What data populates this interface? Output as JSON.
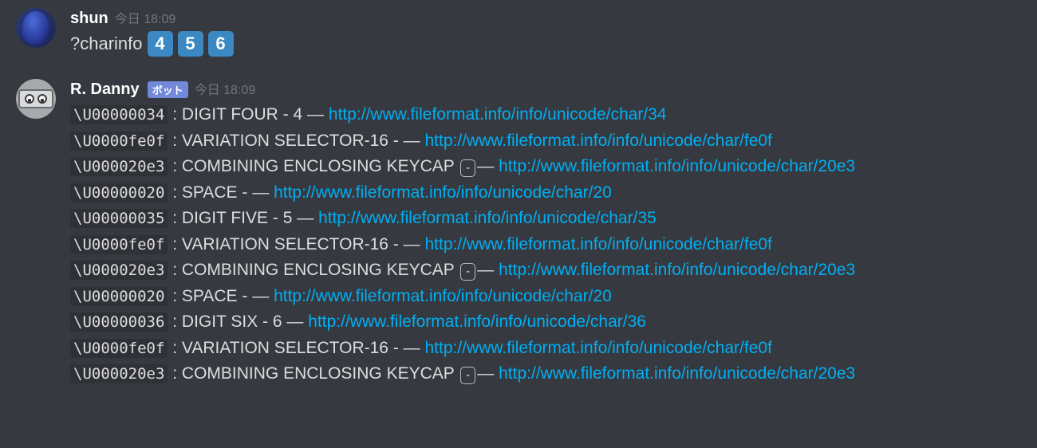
{
  "messages": [
    {
      "avatar_kind": "user",
      "username": "shun",
      "timestamp": "今日 18:09",
      "bot": false,
      "body": {
        "prefix": "?charinfo",
        "keycaps": [
          "4",
          "5",
          "6"
        ]
      }
    },
    {
      "avatar_kind": "bot",
      "username": "R. Danny",
      "timestamp": "今日 18:09",
      "bot": true,
      "bot_tag": "ボット",
      "lines": [
        {
          "code": "\\U00000034",
          "name": "DIGIT FOUR",
          "glyph": "4",
          "boxed": false,
          "url": "http://www.fileformat.info/info/unicode/char/34"
        },
        {
          "code": "\\U0000fe0f",
          "name": "VARIATION SELECTOR-16",
          "glyph": "",
          "boxed": false,
          "url": "http://www.fileformat.info/info/unicode/char/fe0f"
        },
        {
          "code": "\\U000020e3",
          "name": "COMBINING ENCLOSING KEYCAP",
          "glyph": "-",
          "boxed": true,
          "url": "http://www.fileformat.info/info/unicode/char/20e3"
        },
        {
          "code": "\\U00000020",
          "name": "SPACE",
          "glyph": " ",
          "boxed": false,
          "url": "http://www.fileformat.info/info/unicode/char/20"
        },
        {
          "code": "\\U00000035",
          "name": "DIGIT FIVE",
          "glyph": "5",
          "boxed": false,
          "url": "http://www.fileformat.info/info/unicode/char/35"
        },
        {
          "code": "\\U0000fe0f",
          "name": "VARIATION SELECTOR-16",
          "glyph": "",
          "boxed": false,
          "url": "http://www.fileformat.info/info/unicode/char/fe0f"
        },
        {
          "code": "\\U000020e3",
          "name": "COMBINING ENCLOSING KEYCAP",
          "glyph": "-",
          "boxed": true,
          "url": "http://www.fileformat.info/info/unicode/char/20e3"
        },
        {
          "code": "\\U00000020",
          "name": "SPACE",
          "glyph": " ",
          "boxed": false,
          "url": "http://www.fileformat.info/info/unicode/char/20"
        },
        {
          "code": "\\U00000036",
          "name": "DIGIT SIX",
          "glyph": "6",
          "boxed": false,
          "url": "http://www.fileformat.info/info/unicode/char/36"
        },
        {
          "code": "\\U0000fe0f",
          "name": "VARIATION SELECTOR-16",
          "glyph": "",
          "boxed": false,
          "url": "http://www.fileformat.info/info/unicode/char/fe0f"
        },
        {
          "code": "\\U000020e3",
          "name": "COMBINING ENCLOSING KEYCAP",
          "glyph": "-",
          "boxed": true,
          "url": "http://www.fileformat.info/info/unicode/char/20e3"
        }
      ]
    }
  ]
}
